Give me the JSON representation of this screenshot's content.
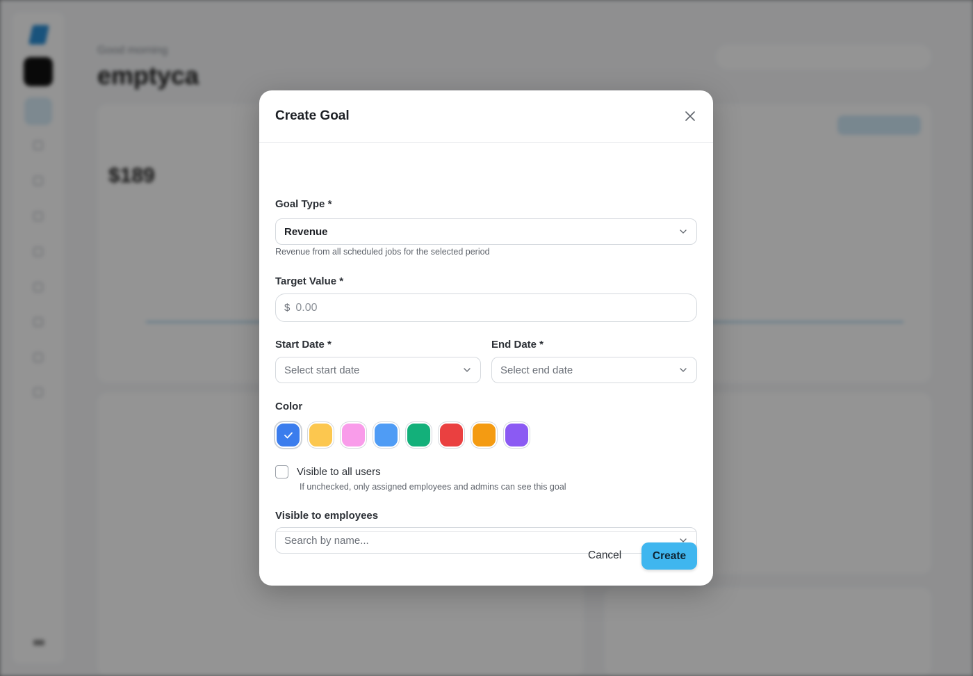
{
  "background": {
    "greeting": "Good morning",
    "title": "emptyca",
    "revenue": "$189"
  },
  "modal": {
    "title": "Create Goal",
    "goal_type": {
      "label": "Goal Type *",
      "value": "Revenue",
      "helper": "Revenue from all scheduled jobs for the selected period"
    },
    "target_value": {
      "label": "Target Value *",
      "currency": "$",
      "placeholder": "0.00"
    },
    "start_date": {
      "label": "Start Date *",
      "placeholder": "Select start date"
    },
    "end_date": {
      "label": "End Date *",
      "placeholder": "Select end date"
    },
    "color": {
      "label": "Color",
      "options": [
        "#3b7ded",
        "#fcc74f",
        "#f99cea",
        "#4f9cf5",
        "#13b07a",
        "#ea4040",
        "#f49b12",
        "#8b5af3"
      ],
      "selected_index": 0
    },
    "visible_all": {
      "label": "Visible to all users",
      "helper": "If unchecked, only assigned employees and admins can see this goal",
      "checked": false
    },
    "visible_employees": {
      "label": "Visible to employees",
      "placeholder": "Search by name..."
    },
    "buttons": {
      "cancel": "Cancel",
      "create": "Create"
    }
  }
}
